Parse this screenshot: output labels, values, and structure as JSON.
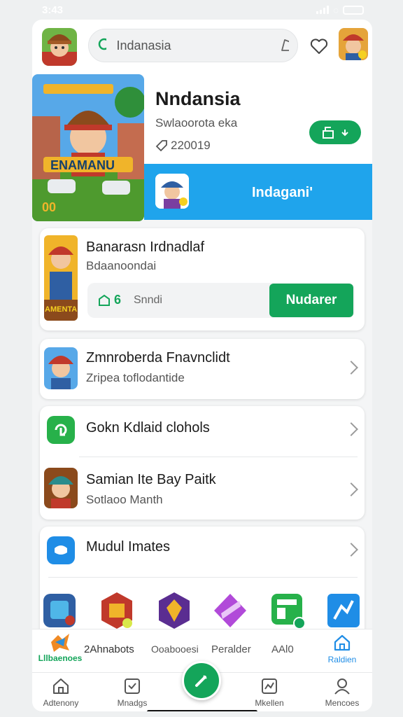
{
  "status_bar": {
    "time": "3:43"
  },
  "top_bar": {
    "search_value": "Indanasia",
    "icons": [
      "search-icon",
      "bookmark-icon",
      "heart-icon"
    ]
  },
  "hero": {
    "title": "Nndansia",
    "subtitle": "Swlaoorota eka",
    "count": "220019",
    "thumb_caption": "ENAMANU",
    "thumb_corner": "00",
    "band_label": "Indagani'"
  },
  "featured_card": {
    "title": "Banarasn Irdnadlaf",
    "subtitle": "Bdaanoondai",
    "meta_number": "6",
    "meta_text": "Snndi",
    "button_label": "Nudarer",
    "thumb_caption": "AMENTA"
  },
  "list": [
    {
      "title": "Zmnroberda Fnavnclidt",
      "subtitle": "Zripea toflodantide"
    },
    {
      "title": "Gokn Kdlaid clohols",
      "subtitle": ""
    },
    {
      "title": "Samian Ite Bay Paitk",
      "subtitle": "Sotlaoo Manth"
    },
    {
      "title": "Mudul Imates",
      "subtitle": ""
    }
  ],
  "nav_upper": [
    "Lllbaenoes",
    "2Ahnabots",
    "Ooabooesi",
    "Peralder",
    "AAl0",
    "Raldien"
  ],
  "nav_lower": [
    "Adtenony",
    "Mnadgs",
    "Mkellen",
    "Mencoes"
  ],
  "colors": {
    "accent_green": "#14a55a",
    "accent_blue": "#1fa4ec"
  }
}
